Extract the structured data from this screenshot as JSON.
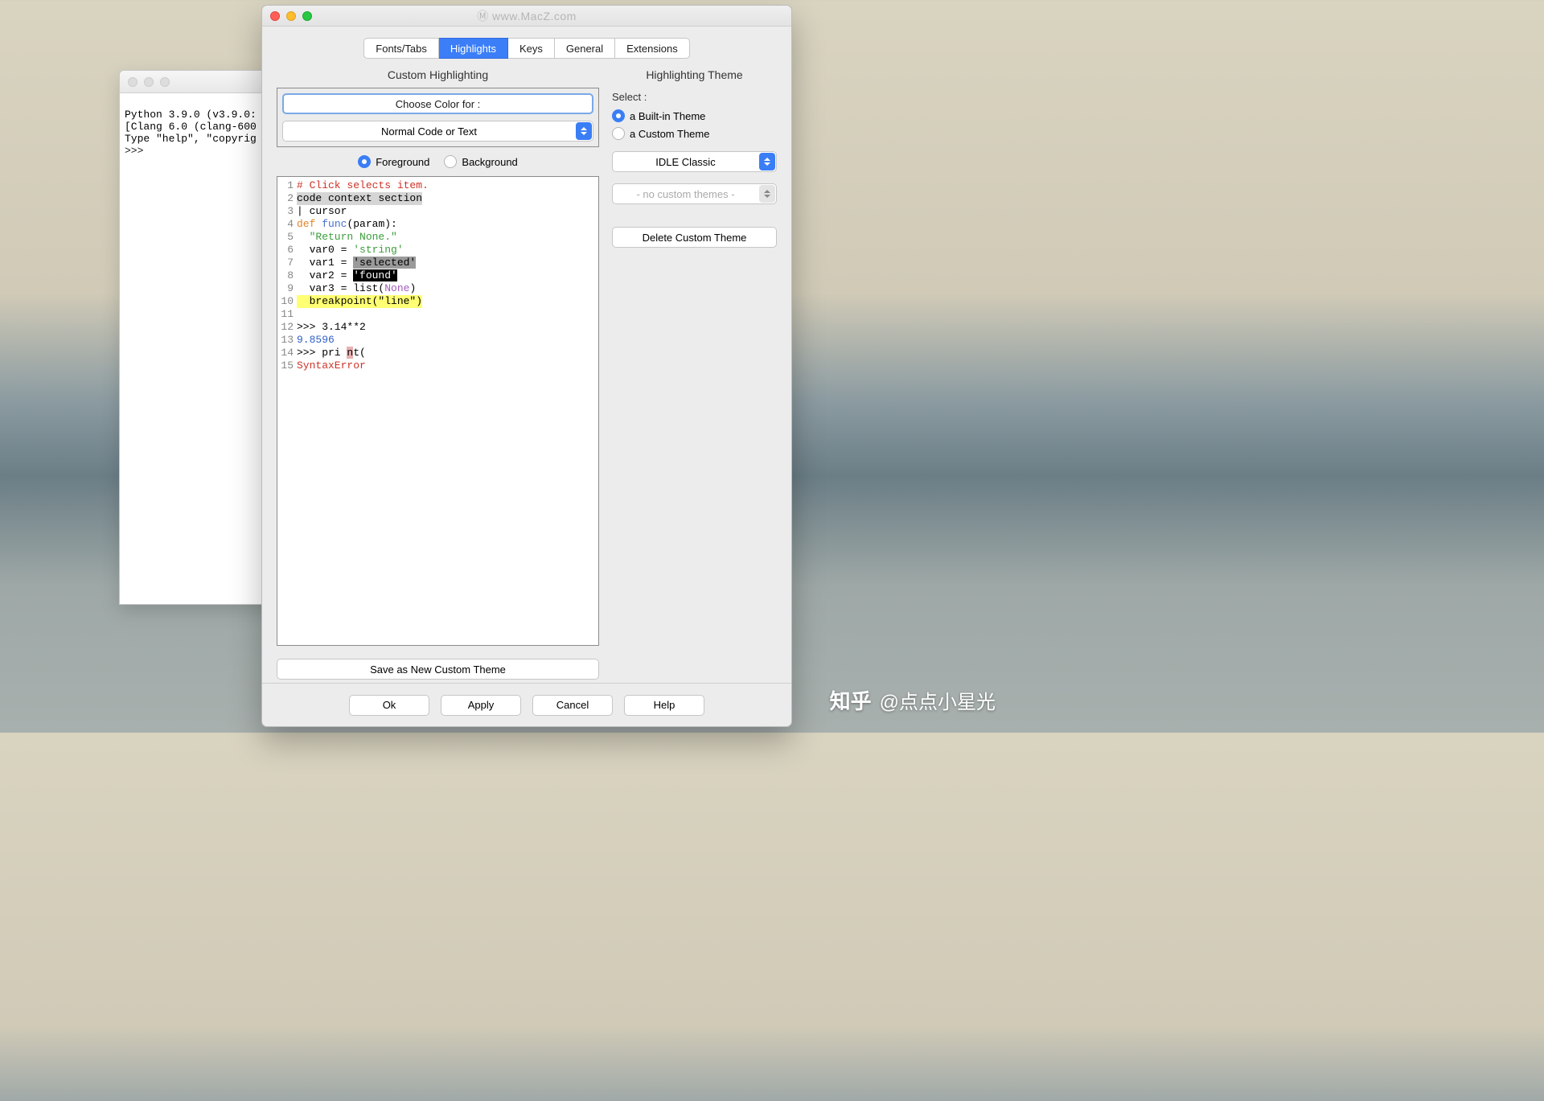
{
  "watermark_top": "Ⓜ www.MacZ.com",
  "watermark_bottom": {
    "logo": "知乎",
    "text": "@点点小星光"
  },
  "shell": {
    "line1": "Python 3.9.0 (v3.9.0:",
    "line2": "[Clang 6.0 (clang-600",
    "line3": "Type \"help\", \"copyrig",
    "prompt": ">>> "
  },
  "tabs": {
    "t0": "Fonts/Tabs",
    "t1": "Highlights",
    "t2": "Keys",
    "t3": "General",
    "t4": "Extensions"
  },
  "left": {
    "title": "Custom Highlighting",
    "choose": "Choose Color for :",
    "selector": "Normal Code or Text",
    "fg": "Foreground",
    "bg": "Background",
    "save": "Save as New Custom Theme"
  },
  "right": {
    "title": "Highlighting Theme",
    "select": "Select :",
    "builtin": "a Built-in Theme",
    "custom": "a Custom Theme",
    "theme": "IDLE Classic",
    "nocustom": "- no custom themes -",
    "delete": "Delete Custom Theme"
  },
  "code": {
    "l1": "# Click selects item.",
    "l2": "code context section",
    "l3": "| cursor",
    "l4a": "def",
    "l4b": " ",
    "l4c": "func",
    "l4d": "(param):",
    "l5": "  \"Return None.\"",
    "l6a": "  var0 = ",
    "l6b": "'string'",
    "l7a": "  var1 = ",
    "l7b": "'selected'",
    "l8a": "  var2 = ",
    "l8b": "'found'",
    "l9a": "  var3 = list(",
    "l9b": "None",
    "l9c": ")",
    "l10a": "  breakpoint(",
    "l10b": "\"line\"",
    "l10c": ")",
    "l12": ">>> 3.14**2",
    "l13": "9.8596",
    "l14a": ">>> pri ",
    "l14b": "n",
    "l14c": "t(",
    "l15": "SyntaxError"
  },
  "footer": {
    "ok": "Ok",
    "apply": "Apply",
    "cancel": "Cancel",
    "help": "Help"
  }
}
